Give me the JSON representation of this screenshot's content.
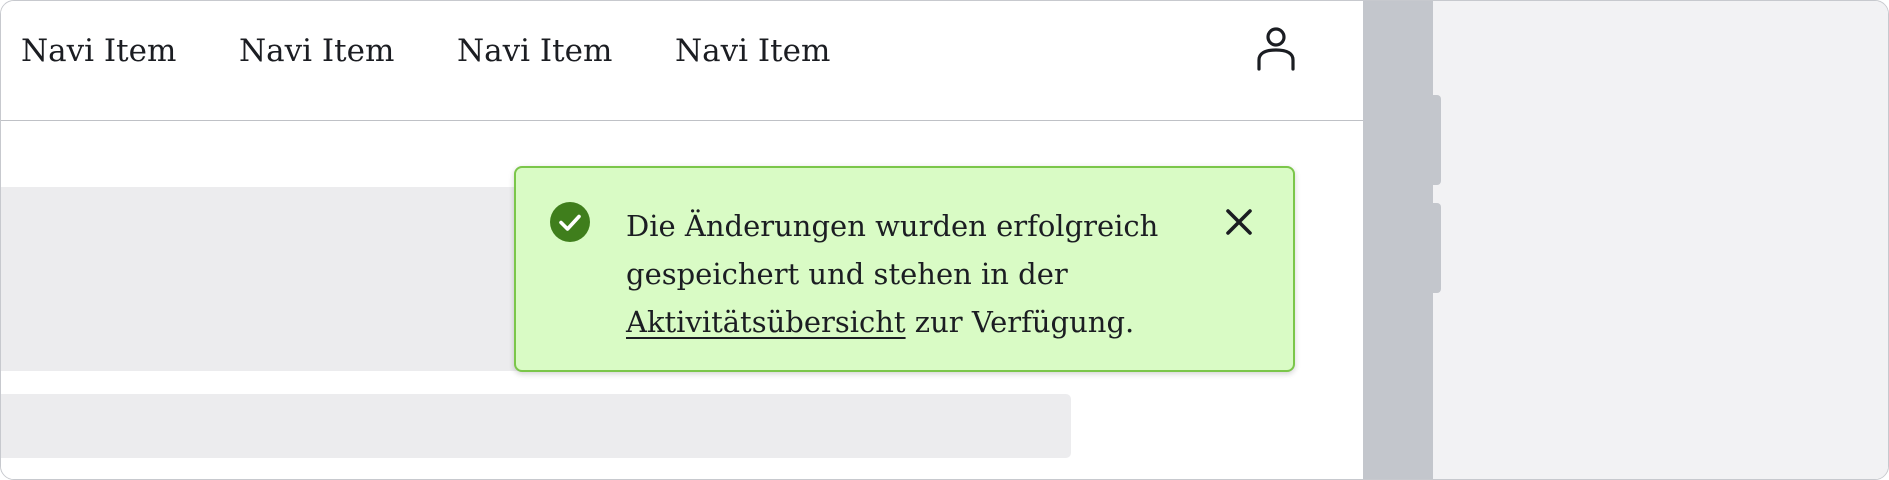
{
  "nav": {
    "items": [
      {
        "label": "Navi Item"
      },
      {
        "label": "Navi Item"
      },
      {
        "label": "Navi Item"
      },
      {
        "label": "Navi Item"
      }
    ],
    "user_icon": "user-icon"
  },
  "toast": {
    "status": "success",
    "icon": "check-circle-icon",
    "message_line1": "Die Änderungen wurden erfolgreich",
    "message_line2": "gespeichert und stehen in der",
    "link_text": "Aktivitätsübersicht",
    "message_tail": " zur Verfügung.",
    "close_icon": "close-icon",
    "colors": {
      "background": "#d9fbc5",
      "border": "#7bc64a",
      "icon": "#3f7e1c"
    }
  },
  "colors": {
    "skeleton": "#ececee",
    "side_panel": "#f2f2f4",
    "scroll_gutter": "#c3c6cc"
  }
}
